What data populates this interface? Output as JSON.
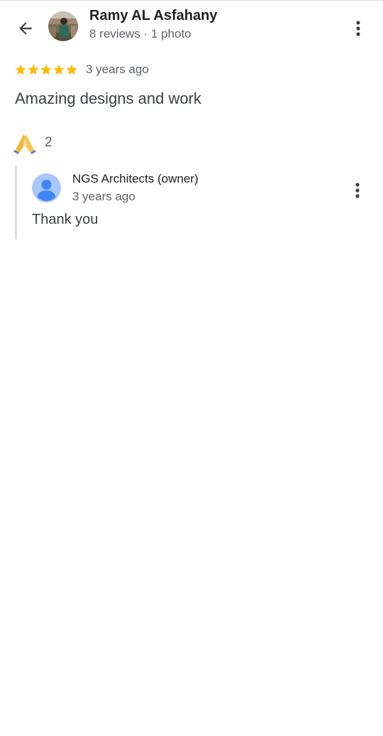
{
  "header": {
    "back_icon": "arrow-back-icon",
    "reviewer_name": "Ramy AL Asfahany",
    "reviewer_meta": "8 reviews · 1 photo",
    "more_icon": "more-vert-icon"
  },
  "review": {
    "rating": 5,
    "rating_max": 5,
    "star_color": "#fbbc04",
    "time_ago": "3 years ago",
    "text": "Amazing designs and work",
    "reaction_icon": "folded-hands-emoji",
    "reaction_count": "2"
  },
  "owner_reply": {
    "name": "NGS Architects (owner)",
    "time_ago": "3 years ago",
    "text": "Thank you",
    "avatar_icon": "person-avatar-icon",
    "more_icon": "more-vert-icon"
  }
}
